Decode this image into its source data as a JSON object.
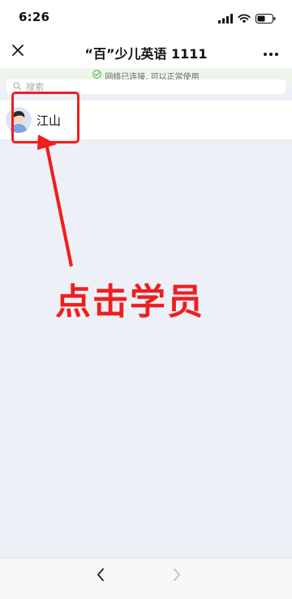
{
  "status_bar": {
    "time": "6:26",
    "icons": [
      "signal-icon",
      "wifi-icon",
      "battery-icon"
    ]
  },
  "nav": {
    "title": "“百”少儿英语 1111",
    "close_icon": "close-icon",
    "more_icon": "more-icon"
  },
  "network": {
    "text": "网络已连接, 可以正常使用",
    "icon": "check-circle-icon"
  },
  "search": {
    "placeholder": "搜索",
    "icon": "search-icon"
  },
  "students": [
    {
      "name": "江山",
      "avatar": "avatar-boy"
    }
  ],
  "annotation": {
    "text": "点击学员",
    "color": "#f01e1e"
  },
  "toolbar": {
    "back_icon": "chevron-left-icon",
    "forward_icon": "chevron-right-icon"
  },
  "colors": {
    "background": "#eef0f7",
    "banner": "#eef6ec",
    "check": "#4caf50",
    "annotation": "#f01e1e"
  }
}
